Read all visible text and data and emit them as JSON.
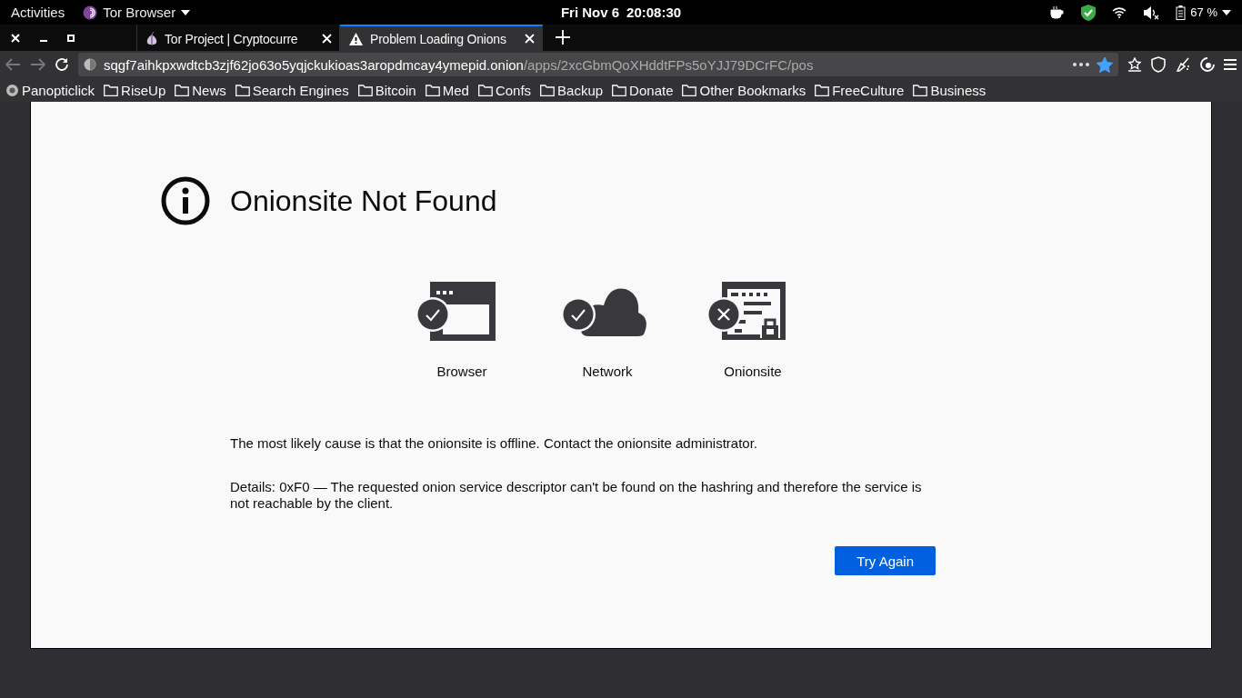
{
  "top_bar": {
    "activities": "Activities",
    "app_name": "Tor Browser",
    "date": "Fri Nov 6",
    "time": "20:08:30",
    "battery": "67 %"
  },
  "tabs": [
    {
      "title": "Tor Project | Cryptocurre",
      "kind": "onion",
      "selected": false
    },
    {
      "title": "Problem Loading Onions",
      "kind": "warning",
      "selected": true
    }
  ],
  "url_bar": {
    "host": "sqgf7aihkpxwdtcb3zjf62jo63o5yqjckukioas3aropdmcay4ymepid.onion",
    "path": "/apps/2xcGbmQoXHddtFPs5oYJJ79DCrFC/pos",
    "bookmarked": true
  },
  "bookmarks": [
    {
      "label": "Panopticlick",
      "kind": "site"
    },
    {
      "label": "RiseUp",
      "kind": "folder"
    },
    {
      "label": "News",
      "kind": "folder"
    },
    {
      "label": "Search Engines",
      "kind": "folder"
    },
    {
      "label": "Bitcoin",
      "kind": "folder"
    },
    {
      "label": "Med",
      "kind": "folder"
    },
    {
      "label": "Confs",
      "kind": "folder"
    },
    {
      "label": "Backup",
      "kind": "folder"
    },
    {
      "label": "Donate",
      "kind": "folder"
    },
    {
      "label": "Other Bookmarks",
      "kind": "folder"
    },
    {
      "label": "FreeCulture",
      "kind": "folder"
    },
    {
      "label": "Business",
      "kind": "folder"
    }
  ],
  "error_page": {
    "title": "Onionsite Not Found",
    "checks": [
      {
        "label": "Browser",
        "kind": "browser",
        "ok": true
      },
      {
        "label": "Network",
        "kind": "network",
        "ok": true
      },
      {
        "label": "Onionsite",
        "kind": "onionsite",
        "ok": false
      }
    ],
    "message": "The most likely cause is that the onionsite is offline. Contact the onionsite administrator.",
    "details": "Details: 0xF0 — The requested onion service descriptor can't be found on the hashring and therefore the service is not reachable by the client.",
    "button": "Try Again"
  }
}
